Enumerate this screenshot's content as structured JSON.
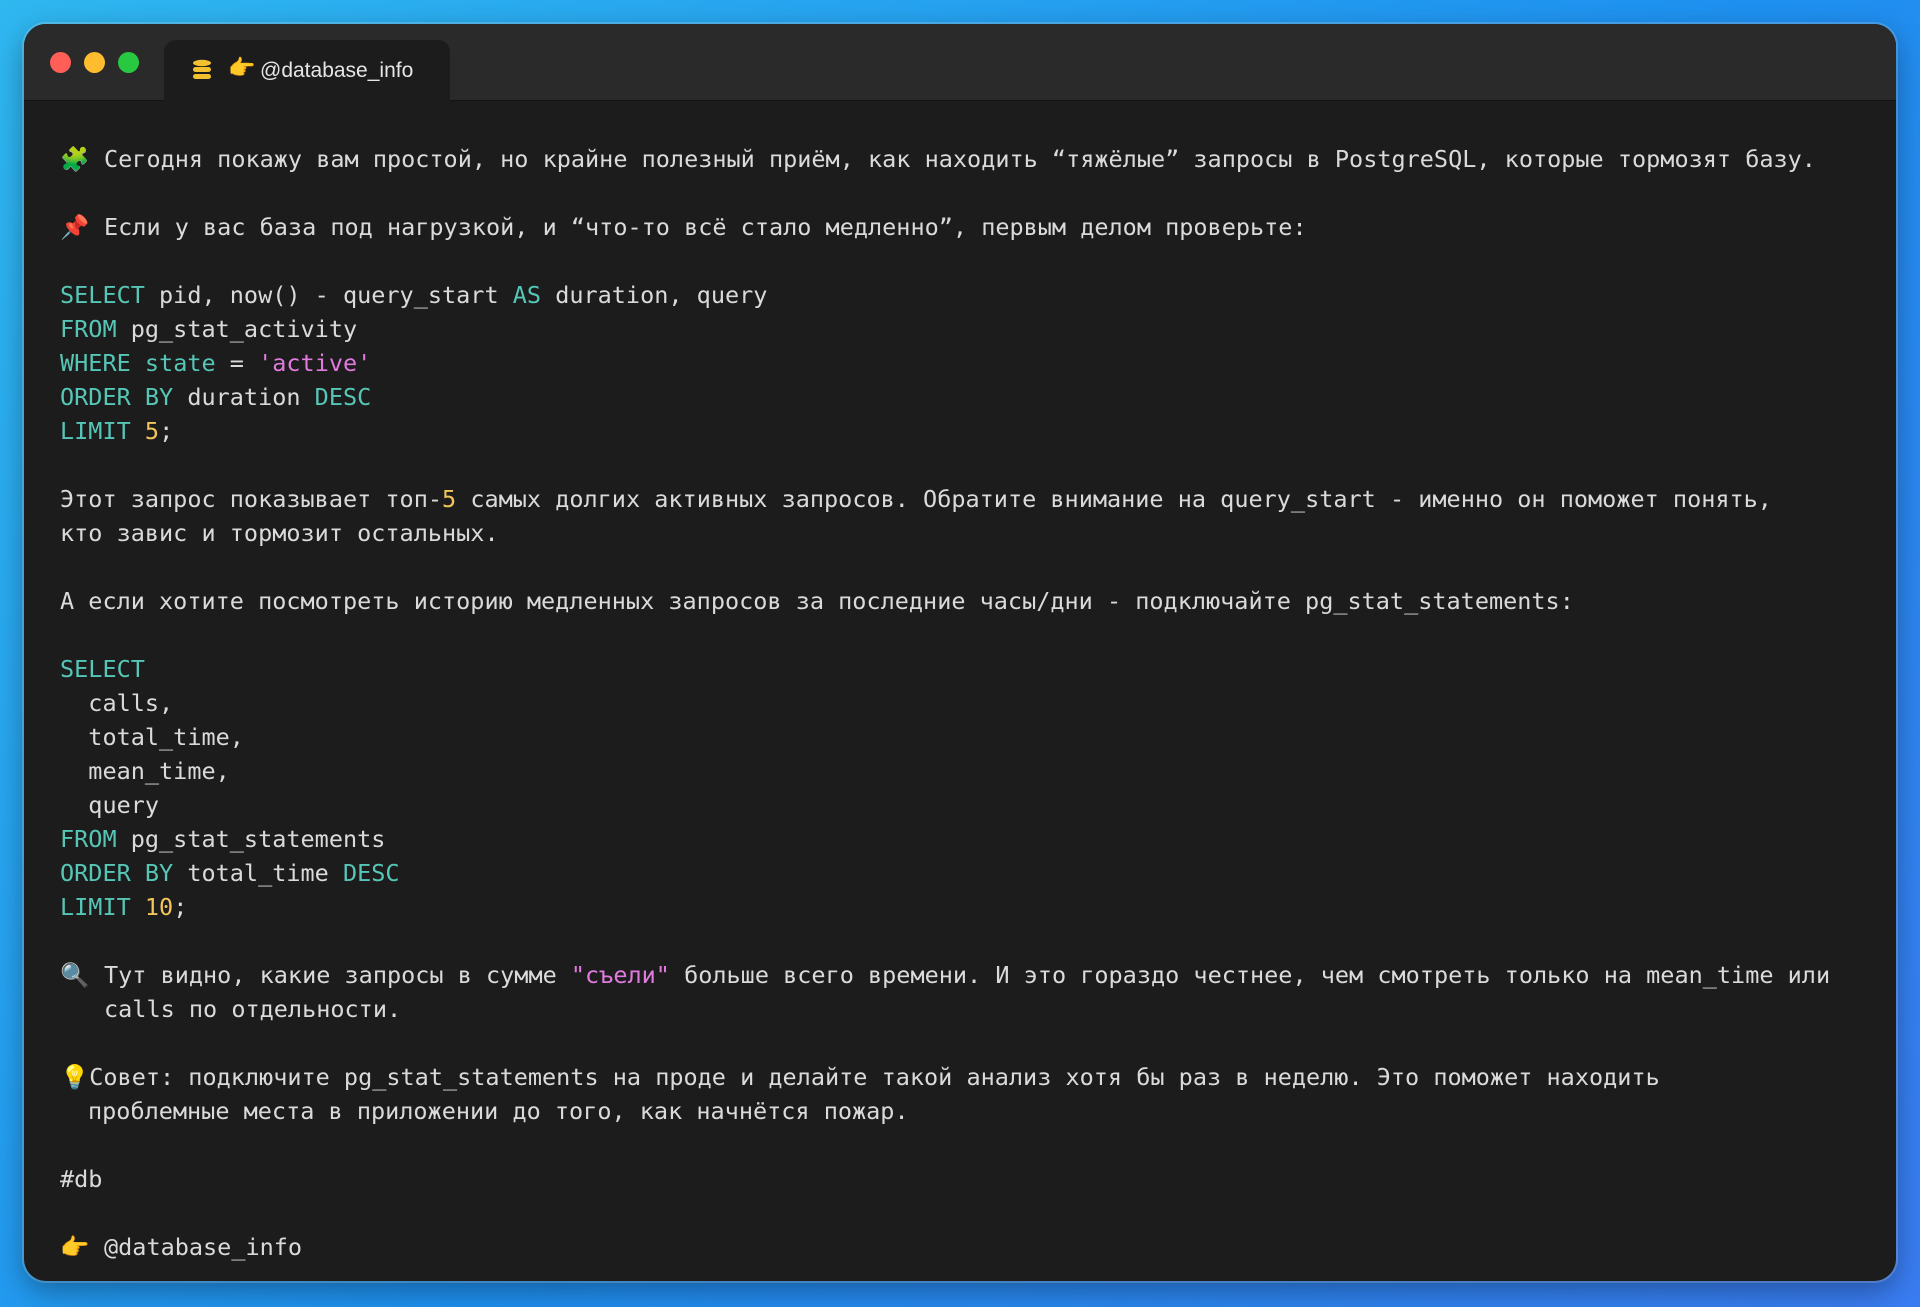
{
  "window": {
    "tab_title": "@database_info",
    "tab_icon": "database-icon",
    "tab_emoji": "👉"
  },
  "post": {
    "intro": {
      "emoji": "🧩",
      "text": "Сегодня покажу вам простой, но крайне полезный приём, как находить “тяжёлые” запросы в PostgreSQL, которые тормозят базу."
    },
    "pin": {
      "emoji": "📌",
      "text": "Если у вас база под нагрузкой, и “что-то всё стало медленно”, первым делом проверьте:"
    },
    "query1": {
      "line1": {
        "kw1": "SELECT",
        "t1": " pid, now() - query_start ",
        "kw2": "AS",
        "t2": " duration, query"
      },
      "line2": {
        "kw": "FROM",
        "t": " pg_stat_activity"
      },
      "line3": {
        "kw1": "WHERE",
        "t1": " ",
        "kw2": "state",
        "t2": " = ",
        "str": "'active'"
      },
      "line4": {
        "kw1": "ORDER BY",
        "t": " duration ",
        "kw2": "DESC"
      },
      "line5": {
        "kw": "LIMIT",
        "t": " ",
        "num": "5",
        "end": ";"
      }
    },
    "explain1": {
      "part1": "Этот запрос показывает топ-",
      "num": "5",
      "part2": " самых долгих активных запросов. Обратите внимание на query_start - именно он поможет понять,",
      "line2": "кто завис и тормозит остальных."
    },
    "history": "А если хотите посмотреть историю медленных запросов за последние часы/дни - подключайте pg_stat_statements:",
    "query2": {
      "line1": "SELECT",
      "line2": "  calls,",
      "line3": "  total_time,",
      "line4": "  mean_time,",
      "line5": "  query",
      "line6": {
        "kw": "FROM",
        "t": " pg_stat_statements"
      },
      "line7": {
        "kw1": "ORDER BY",
        "t": " total_time ",
        "kw2": "DESC"
      },
      "line8": {
        "kw": "LIMIT",
        "t": " ",
        "num": "10",
        "end": ";"
      }
    },
    "insight": {
      "emoji": "🔍",
      "part1": "Тут видно, какие запросы в сумме ",
      "str": "\"съели\"",
      "part2": " больше всего времени. И это гораздо честнее, чем смотреть только на mean_time или",
      "line2": "calls по отдельности."
    },
    "tip": {
      "emoji": "💡",
      "line1": "Совет: подключите pg_stat_statements на проде и делайте такой анализ хотя бы раз в неделю. Это поможет находить",
      "line2": "проблемные места в приложении до того, как начнётся пожар."
    },
    "hashtag": "#db",
    "signature": {
      "emoji": "👉",
      "text": "@database_info"
    }
  }
}
